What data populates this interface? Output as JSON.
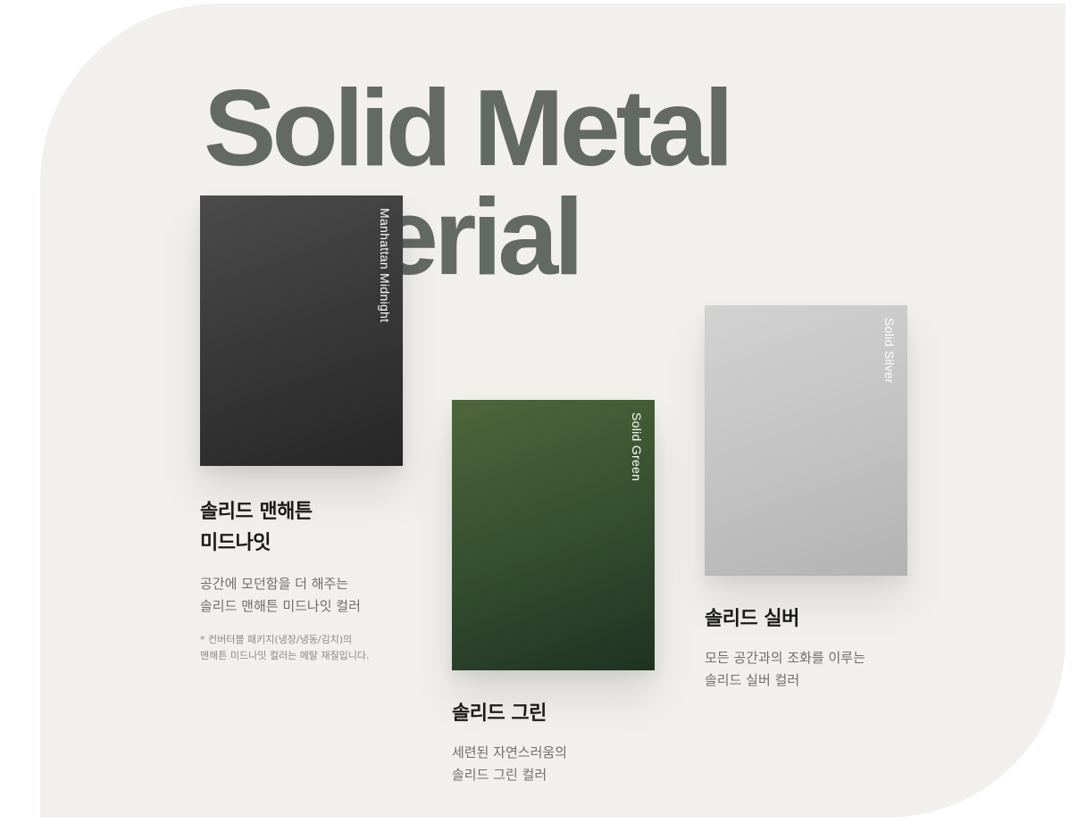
{
  "headline": "Solid Metal Material",
  "swatches": [
    {
      "english_name": "Manhattan Midnight",
      "title": "솔리드 맨해튼\n미드나잇",
      "description": "공간에 모던함을 더 해주는\n솔리드 맨해튼 미드나잇 컬러",
      "note": "* 컨버터블 패키지(냉장/냉동/김치)의\n맨해튼 미드나잇 컬러는 메탈 재질입니다.",
      "color": "#3a3a3a"
    },
    {
      "english_name": "Solid Green",
      "title": "솔리드 그린",
      "description": "세련된 자연스러움의\n솔리드 그린 컬러",
      "color": "#35502f"
    },
    {
      "english_name": "Solid Silver",
      "title": "솔리드 실버",
      "description": "모든 공간과의 조화를 이루는\n솔리드 실버 컬러",
      "color": "#c4c4c4"
    }
  ],
  "colors": {
    "panel_background": "#f1f0ec",
    "headline_color": "#636a63"
  }
}
